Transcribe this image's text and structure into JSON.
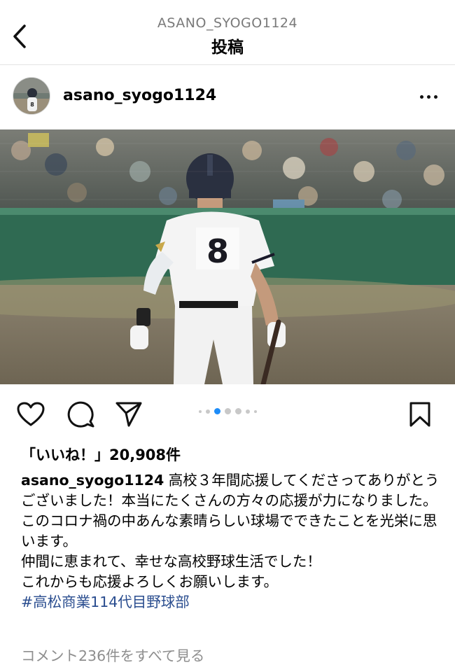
{
  "header": {
    "username": "ASANO_SYOGO1124",
    "title": "投稿"
  },
  "post": {
    "username": "asano_syogo1124",
    "image_subject": "Baseball player number 8 walking on field holding bat",
    "jersey_number": "8",
    "carousel": {
      "count": 6,
      "active_index": 2
    },
    "likes_text": "「いいね！」20,908件",
    "caption": {
      "user": "asano_syogo1124",
      "line1": "高校３年間応援してくださってありがとうございました！本当にたくさんの方々の応援が力になりました。",
      "line2": "このコロナ禍の中あんな素晴らしい球場でできたことを光栄に思います。",
      "line3": "仲間に恵まれて、幸せな高校野球生活でした！",
      "line4": "これからも応援よろしくお願いします。",
      "hashtag": "#高松商業114代目野球部"
    },
    "comments_link": "コメント236件をすべて見る"
  },
  "colors": {
    "hashtag": "#2a4d8f",
    "muted": "#8e8e8e",
    "active_dot": "#1d8cf8"
  },
  "icons": [
    "chevron-left-icon",
    "more-horizontal-icon",
    "heart-icon",
    "comment-icon",
    "share-icon",
    "bookmark-icon"
  ]
}
